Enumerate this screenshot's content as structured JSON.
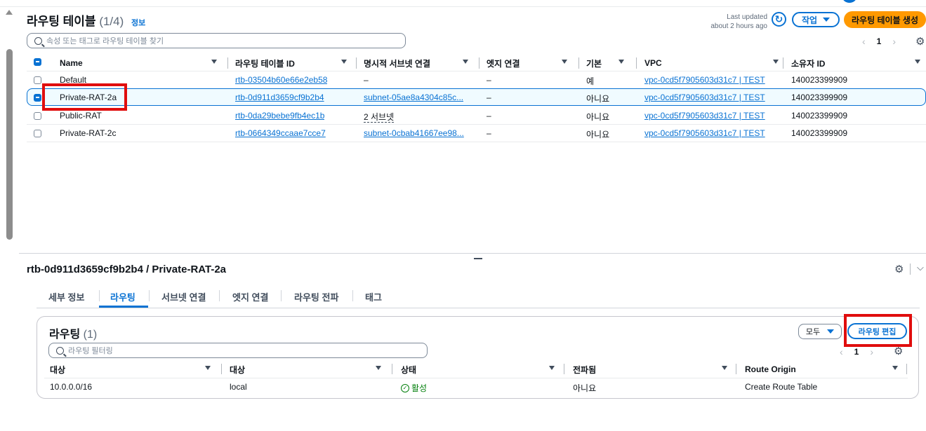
{
  "route_tables": {
    "title": "라우팅 테이블",
    "count": "(1/4)",
    "info_label": "정보",
    "last_updated_label": "Last updated",
    "last_updated_value": "about 2 hours ago",
    "actions_label": "작업",
    "create_label": "라우팅 테이블 생성",
    "search_placeholder": "속성 또는 태그로 라우팅 테이블 찾기",
    "page": "1",
    "columns": [
      "Name",
      "라우팅 테이블 ID",
      "명시적 서브넷 연결",
      "엣지 연결",
      "기본",
      "VPC",
      "소유자 ID"
    ],
    "rows": [
      {
        "name": "Default",
        "id": "rtb-03504b60e66e2eb58",
        "subnet": "–",
        "edge": "–",
        "main": "예",
        "vpc": "vpc-0cd5f7905603d31c7 | TEST",
        "owner": "140023399909",
        "selected": false
      },
      {
        "name": "Private-RAT-2a",
        "id": "rtb-0d911d3659cf9b2b4",
        "subnet": "subnet-05ae8a4304c85c...",
        "edge": "–",
        "main": "아니요",
        "vpc": "vpc-0cd5f7905603d31c7 | TEST",
        "owner": "140023399909",
        "selected": true
      },
      {
        "name": "Public-RAT",
        "id": "rtb-0da29bebe9fb4ec1b",
        "subnet": "2 서브넷",
        "edge": "–",
        "main": "아니요",
        "vpc": "vpc-0cd5f7905603d31c7 | TEST",
        "owner": "140023399909",
        "selected": false
      },
      {
        "name": "Private-RAT-2c",
        "id": "rtb-0664349ccaae7cce7",
        "subnet": "subnet-0cbab41667ee98...",
        "edge": "–",
        "main": "아니요",
        "vpc": "vpc-0cd5f7905603d31c7 | TEST",
        "owner": "140023399909",
        "selected": false
      }
    ]
  },
  "detail": {
    "title": "rtb-0d911d3659cf9b2b4 / Private-RAT-2a",
    "tabs": [
      "세부 정보",
      "라우팅",
      "서브넷 연결",
      "엣지 연결",
      "라우팅 전파",
      "태그"
    ],
    "active_tab": "라우팅"
  },
  "routes": {
    "title": "라우팅",
    "count": "(1)",
    "filter_label": "모두",
    "edit_label": "라우팅 편집",
    "search_placeholder": "라우팅 필터링",
    "page": "1",
    "columns": [
      "대상",
      "대상",
      "상태",
      "전파됨",
      "Route Origin"
    ],
    "rows": [
      {
        "destination": "10.0.0.0/16",
        "target": "local",
        "status": "활성",
        "propagated": "아니요",
        "origin": "Create Route Table"
      }
    ]
  },
  "colors": {
    "accent": "#0972d3",
    "primary_button": "#ff9900",
    "highlight": "#e00d0d",
    "success": "#037f0c"
  }
}
